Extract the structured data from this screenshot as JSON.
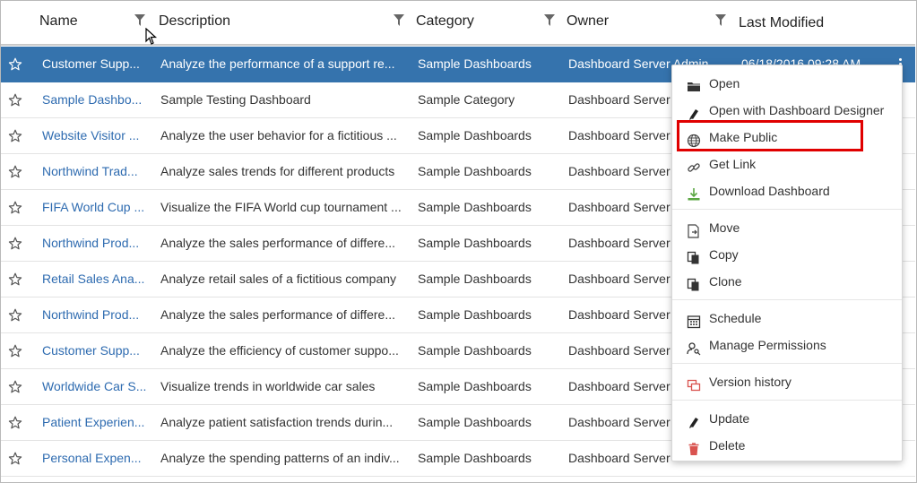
{
  "columns": {
    "name": "Name",
    "description": "Description",
    "category": "Category",
    "owner": "Owner",
    "last_modified": "Last Modified"
  },
  "rows": [
    {
      "name": "Customer Supp...",
      "description": "Analyze the performance of a support re...",
      "category": "Sample Dashboards",
      "owner": "Dashboard Server Admin",
      "modified": "06/18/2016 09:28 AM",
      "selected": true
    },
    {
      "name": "Sample Dashbo...",
      "description": "Sample Testing Dashboard",
      "category": "Sample Category",
      "owner": "Dashboard Server",
      "modified": ""
    },
    {
      "name": "Website Visitor ...",
      "description": "Analyze the user behavior for a fictitious ...",
      "category": "Sample Dashboards",
      "owner": "Dashboard Server",
      "modified": ""
    },
    {
      "name": "Northwind Trad...",
      "description": "Analyze sales trends for different products",
      "category": "Sample Dashboards",
      "owner": "Dashboard Server",
      "modified": ""
    },
    {
      "name": "FIFA World Cup ...",
      "description": "Visualize the FIFA World cup tournament ...",
      "category": "Sample Dashboards",
      "owner": "Dashboard Server",
      "modified": ""
    },
    {
      "name": "Northwind Prod...",
      "description": "Analyze the sales performance of differe...",
      "category": "Sample Dashboards",
      "owner": "Dashboard Server",
      "modified": ""
    },
    {
      "name": "Retail Sales Ana...",
      "description": "Analyze retail sales of a fictitious company",
      "category": "Sample Dashboards",
      "owner": "Dashboard Server",
      "modified": ""
    },
    {
      "name": "Northwind Prod...",
      "description": "Analyze the sales performance of differe...",
      "category": "Sample Dashboards",
      "owner": "Dashboard Server",
      "modified": ""
    },
    {
      "name": "Customer Supp...",
      "description": "Analyze the efficiency of customer suppo...",
      "category": "Sample Dashboards",
      "owner": "Dashboard Server",
      "modified": ""
    },
    {
      "name": "Worldwide Car S...",
      "description": "Visualize trends in worldwide car sales",
      "category": "Sample Dashboards",
      "owner": "Dashboard Server",
      "modified": ""
    },
    {
      "name": "Patient Experien...",
      "description": "Analyze patient satisfaction trends durin...",
      "category": "Sample Dashboards",
      "owner": "Dashboard Server",
      "modified": ""
    },
    {
      "name": "Personal Expen...",
      "description": "Analyze the spending patterns of an indiv...",
      "category": "Sample Dashboards",
      "owner": "Dashboard Server",
      "modified": ""
    }
  ],
  "context_menu": {
    "items": [
      {
        "label": "Open",
        "icon": "folder-icon"
      },
      {
        "label": "Open with Dashboard Designer",
        "icon": "pen-icon"
      },
      {
        "label": "Make Public",
        "icon": "globe-icon",
        "highlighted": true
      },
      {
        "label": "Get Link",
        "icon": "link-icon"
      },
      {
        "label": "Download Dashboard",
        "icon": "download-icon"
      },
      {
        "label": "Move",
        "icon": "move-icon"
      },
      {
        "label": "Copy",
        "icon": "copy-icon"
      },
      {
        "label": "Clone",
        "icon": "clone-icon"
      },
      {
        "label": "Schedule",
        "icon": "calendar-icon"
      },
      {
        "label": "Manage Permissions",
        "icon": "user-key-icon"
      },
      {
        "label": "Version history",
        "icon": "version-icon"
      },
      {
        "label": "Update",
        "icon": "pen-icon"
      },
      {
        "label": "Delete",
        "icon": "trash-icon"
      }
    ]
  },
  "colors": {
    "selected_row": "#3573ad",
    "link_text": "#2e6bb0",
    "highlight_box": "#e00000"
  }
}
